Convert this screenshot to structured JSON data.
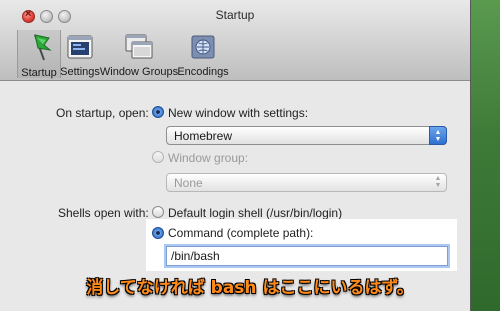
{
  "window": {
    "title": "Startup"
  },
  "toolbar": {
    "items": [
      {
        "label": "Startup",
        "icon": "flag-icon",
        "selected": true
      },
      {
        "label": "Settings",
        "icon": "settings-icon",
        "selected": false
      },
      {
        "label": "Window Groups",
        "icon": "window-groups-icon",
        "selected": false
      },
      {
        "label": "Encodings",
        "icon": "encodings-icon",
        "selected": false
      }
    ]
  },
  "startup": {
    "on_startup_label": "On startup, open:",
    "new_window_label": "New window with settings:",
    "settings_value": "Homebrew",
    "window_group_label": "Window group:",
    "window_group_value": "None",
    "shells_open_label": "Shells open with:",
    "default_shell_label": "Default login shell (/usr/bin/login)",
    "command_label": "Command (complete path):",
    "command_value": "/bin/bash"
  },
  "caption": "消してなければ bash はここにいるはず。",
  "colors": {
    "accent": "#3a7ad0",
    "caption": "#ff8a1a",
    "desktop": "#3f7a3c"
  }
}
